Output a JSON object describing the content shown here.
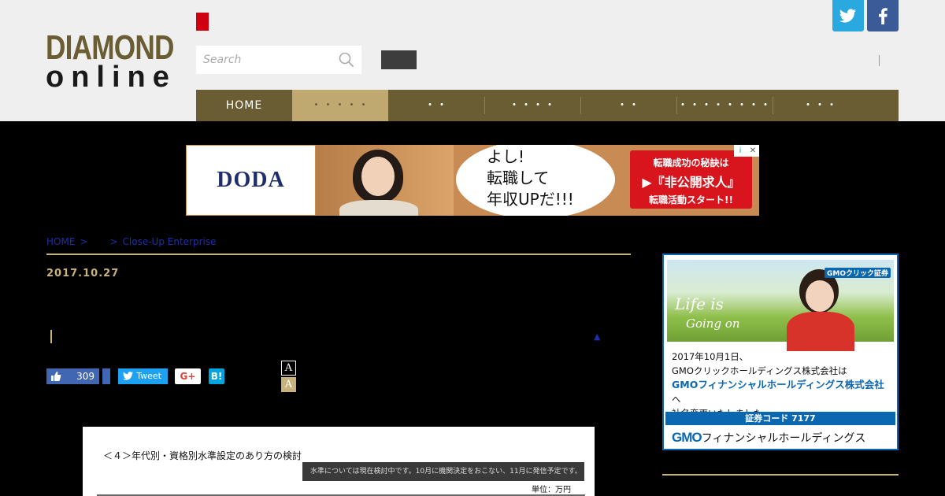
{
  "header": {
    "logo_top": "DIAMOND",
    "logo_bottom": "online",
    "search_placeholder": "Search",
    "social": {
      "twitter": "twitter-icon",
      "facebook": "facebook-icon"
    },
    "separator": "|"
  },
  "nav": {
    "items": [
      {
        "label": "HOME"
      },
      {
        "label": "・・・・・"
      },
      {
        "label": "・・"
      },
      {
        "label": "・・・・"
      },
      {
        "label": "・・"
      },
      {
        "label": "・・・・・・・・"
      },
      {
        "label": "・・・"
      }
    ],
    "active_index": 1
  },
  "ad_banner": {
    "brand": "DODA",
    "copy_line1": "よし!",
    "copy_line2": "転職して",
    "copy_line3": "年収UPだ!!!",
    "cta_line1": "転職成功の秘訣は",
    "cta_line2": "▶『非公開求人』",
    "cta_line3": "転職活動スタート!!",
    "adchoice_i": "i",
    "adchoice_x": "✕"
  },
  "breadcrumb": {
    "home": "HOME",
    "sep1": ">",
    "sep2": ">",
    "current": "Close-Up Enterprise"
  },
  "article": {
    "date": "2017.10.27",
    "up_arrow": "▲"
  },
  "share": {
    "like_count": "309",
    "tweet_label": "Tweet",
    "gplus_label": "G+",
    "hatena_label": "B!"
  },
  "font_size": {
    "small": "A",
    "large": "A"
  },
  "doc_image": {
    "title": "＜４＞年代別・資格別水準設定のあり方の検討",
    "note": "水準については現在検討中です。10月に機関決定をおこない、11月に発信予定です。",
    "unit": "単位：万円"
  },
  "side_ad": {
    "badge": "GMOクリック証券",
    "life_is": "Life is",
    "going_on": "Going on",
    "text1": "2017年10月1日、",
    "text2": "GMOクリックホールディングス株式会社は",
    "text3_blue": "GMOフィナンシャルホールディングス株式会社",
    "text3_suffix": "へ",
    "text4": "社名変更いたしました。",
    "code": "証券コード 7177",
    "gmo_brand": "GMO",
    "gmo_name": "フィナンシャルホールディングス"
  },
  "colors": {
    "brand_olive": "#6a5d33",
    "gold": "#c8b27c",
    "nav_active": "#bfa970",
    "red_mark": "#d10010"
  }
}
